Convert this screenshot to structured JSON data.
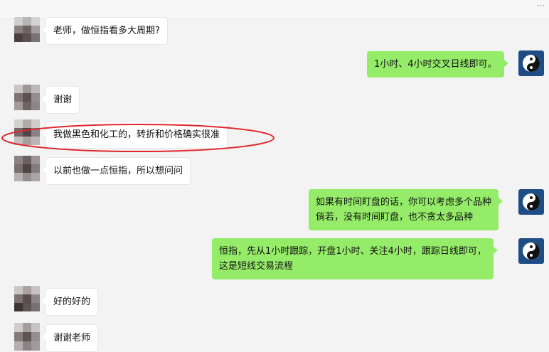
{
  "toolbar": {
    "more_label": "···"
  },
  "messages": {
    "m1": "老师，做恒指看多大周期?",
    "m2": "1小时、4小时交叉日线即可。",
    "m3": "谢谢",
    "m4": "我做黑色和化工的，转折和价格确实很准",
    "m5": "以前也做一点恒指，所以想问问",
    "m6": {
      "l1": "如果有时间盯盘的话，你可以考虑多个品种",
      "l2": "倘若，没有时间盯盘，也不贪太多品种"
    },
    "m7": {
      "l1": "恒指，先从1小时跟踪，开盘1小时、关注4小时，跟踪日线即可，",
      "l2": "这是短线交易流程"
    },
    "m8": "好的好的",
    "m9": "谢谢老师"
  },
  "icons": {
    "self_avatar": "yin-yang-icon",
    "user_avatar": "pixelated-avatar"
  },
  "colors": {
    "self_bubble": "#95ec69",
    "other_bubble": "#ffffff",
    "highlight_ellipse": "#e0262b",
    "avatar_bg": "#1e4d86"
  }
}
